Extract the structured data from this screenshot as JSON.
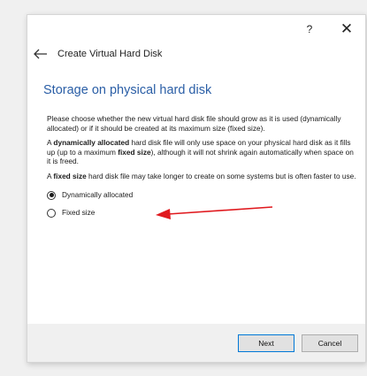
{
  "window": {
    "help_label": "?",
    "close_label": "✕",
    "subtitle": "Create Virtual Hard Disk"
  },
  "page": {
    "heading": "Storage on physical hard disk",
    "para1": "Please choose whether the new virtual hard disk file should grow as it is used (dynamically allocated) or if it should be created at its maximum size (fixed size).",
    "para2": {
      "prefix": "A ",
      "bold1": "dynamically allocated",
      "middle": " hard disk file will only use space on your physical hard disk as it fills up (up to a maximum ",
      "bold2": "fixed size",
      "suffix": "), although it will not shrink again automatically when space on it is freed."
    },
    "para3": {
      "prefix": "A ",
      "bold": "fixed size",
      "suffix": " hard disk file may take longer to create on some systems but is often faster to use."
    },
    "options": [
      {
        "label": "Dynamically allocated",
        "selected": true
      },
      {
        "label": "Fixed size",
        "selected": false
      }
    ]
  },
  "buttons": {
    "next": "Next",
    "cancel": "Cancel"
  },
  "colors": {
    "heading": "#2a5ea6",
    "annotation_arrow": "#e0191e",
    "default_button_border": "#0078d7"
  },
  "icons": {
    "back": "left-arrow-icon",
    "close": "close-icon",
    "help": "help-icon"
  }
}
